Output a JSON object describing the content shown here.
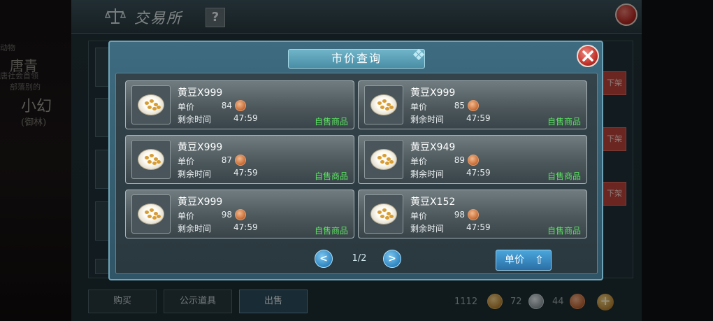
{
  "background": {
    "left_panel_lines": [
      "动物",
      "唐青",
      "唐社会首领",
      "部落别的",
      "小幻",
      "(御林)"
    ],
    "window_title": "交易所",
    "help_label": "?",
    "side_buttons": [
      "下架",
      "下架",
      "下架"
    ],
    "tabs": [
      {
        "label": "购买"
      },
      {
        "label": "公示道具"
      },
      {
        "label": "出售"
      }
    ],
    "currency": {
      "gold": "1112",
      "silver": "72",
      "copper": "44"
    },
    "plus_label": "+"
  },
  "modal": {
    "title": "市价查询",
    "title_ornament": "❖",
    "price_label": "单价",
    "time_label": "剩余时间",
    "items": [
      {
        "name": "黄豆X999",
        "price": "84",
        "time": "47:59",
        "tag": "自售商品"
      },
      {
        "name": "黄豆X999",
        "price": "85",
        "time": "47:59",
        "tag": "自售商品"
      },
      {
        "name": "黄豆X999",
        "price": "87",
        "time": "47:59",
        "tag": "自售商品"
      },
      {
        "name": "黄豆X949",
        "price": "89",
        "time": "47:59",
        "tag": "自售商品"
      },
      {
        "name": "黄豆X999",
        "price": "98",
        "time": "47:59",
        "tag": "自售商品"
      },
      {
        "name": "黄豆X152",
        "price": "98",
        "time": "47:59",
        "tag": "自售商品"
      }
    ],
    "pagination": {
      "prev": "<",
      "page_indicator": "1/2",
      "next": ">"
    },
    "sort_button": {
      "label": "单价",
      "arrow": "⇧"
    }
  }
}
